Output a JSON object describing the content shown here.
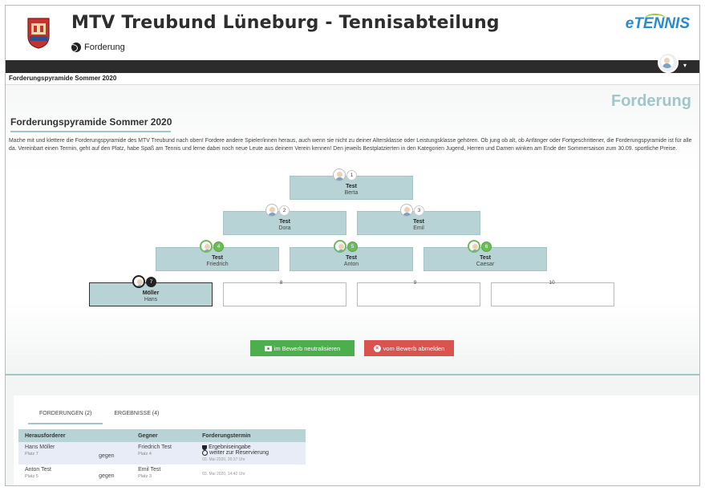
{
  "header": {
    "club_title": "MTV Treubund Lüneburg - Tennisabteilung",
    "sub_nav": "Forderung",
    "brand": "eTENNIS"
  },
  "breadcrumb": "Forderungspyramide Sommer 2020",
  "page_heading": "Forderung",
  "section_title": "Forderungspyramide Sommer 2020",
  "intro": "Mache mit und klettere die Forderungspyramide des MTV Treubund nach oben! Fordere andere Spieler/innen heraus, auch wenn sie nicht zu deiner Altersklasse oder Leistungsklasse gehören. Ob jung ob alt, ob Anfänger oder Fortgeschrittener, die Forderungspyramide ist für alle da. Vereinbart einen Termin, geht auf den Platz, habe Spaß am Tennis und lerne dabei noch neue Leute aus deinem Verein kennen! Den jeweils Bestplatzierten in den Kategorien Jugend, Herren und Damen winken am Ende der Sommersaison zum 30.09. sportliche Preise.",
  "pyramid": {
    "p1": {
      "rank": "1",
      "name": "Test",
      "first": "Berta"
    },
    "p2": {
      "rank": "2",
      "name": "Test",
      "first": "Dora"
    },
    "p3": {
      "rank": "3",
      "name": "Test",
      "first": "Emil"
    },
    "p4": {
      "rank": "4",
      "name": "Test",
      "first": "Friedrich"
    },
    "p5": {
      "rank": "5",
      "name": "Test",
      "first": "Anton"
    },
    "p6": {
      "rank": "6",
      "name": "Test",
      "first": "Caesar"
    },
    "p7": {
      "rank": "7",
      "name": "Möller",
      "first": "Hans"
    },
    "p8": {
      "rank": "8"
    },
    "p9": {
      "rank": "9"
    },
    "p10": {
      "rank": "10"
    }
  },
  "buttons": {
    "neutralize": "im Bewerb neutralisieren",
    "unsubscribe": "vom Bewerb abmelden"
  },
  "tabs": {
    "challenges": "FORDERUNGEN (2)",
    "results": "ERGEBNISSE (4)"
  },
  "table": {
    "headers": [
      "Herausforderer",
      "Gegner",
      "Forderungstermin"
    ],
    "rows": [
      {
        "challenger": "Hans Möller",
        "challenger_place": "Platz 7",
        "vs": "gegen",
        "opponent": "Friedrich Test",
        "opponent_place": "Platz 4",
        "action1": "Ergebniseingabe",
        "action2": "weiter zur Reservierung",
        "stamp": "03. Mai 2020, 20:37 Uhr"
      },
      {
        "challenger": "Anton Test",
        "challenger_place": "Platz 5",
        "vs": "gegen",
        "opponent": "Emil Test",
        "opponent_place": "Platz 3",
        "stamp": "03. Mai 2020, 14:42 Uhr"
      }
    ]
  },
  "colors": {
    "accent": "#9fc6c9",
    "slot_fill": "#b8d3d5",
    "green": "#4cae4c",
    "red": "#d9534f",
    "brand_blue": "#2a8bc6"
  }
}
